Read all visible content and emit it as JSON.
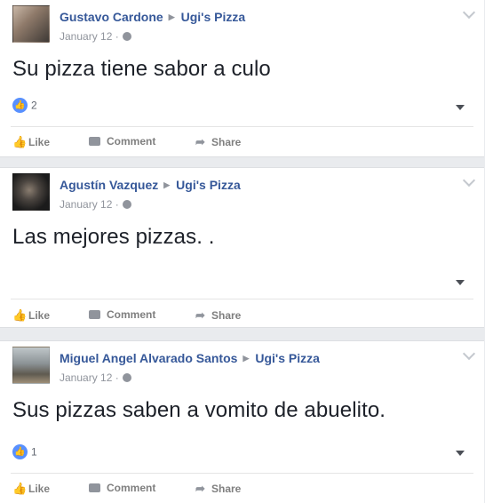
{
  "posts": [
    {
      "author": "Gustavo Cardone",
      "page": "Ugi's Pizza",
      "date": "January 12 ·",
      "text": "Su pizza tiene sabor a culo",
      "like_count": "2"
    },
    {
      "author": "Agustín Vazquez",
      "page": "Ugi's Pizza",
      "date": "January 12 ·",
      "text": "Las mejores pizzas. .",
      "like_count": ""
    },
    {
      "author": "Miguel Angel Alvarado Santos",
      "page": "Ugi's Pizza",
      "date": "January 12 ·",
      "text": "Sus pizzas saben a vomito de abuelito.",
      "like_count": "1"
    }
  ],
  "actions": {
    "like_label": "Like",
    "comment_label": "Comment",
    "share_label": "Share"
  },
  "icons": {
    "like": "thumbs-up-icon",
    "comment": "comment-icon",
    "share": "share-arrow-icon",
    "privacy": "globe-icon",
    "options": "chevron-down-icon"
  },
  "colors": {
    "link_blue": "#365899",
    "like_blue": "#5890ff",
    "meta_gray": "#90949c",
    "background": "#e9ebee"
  }
}
